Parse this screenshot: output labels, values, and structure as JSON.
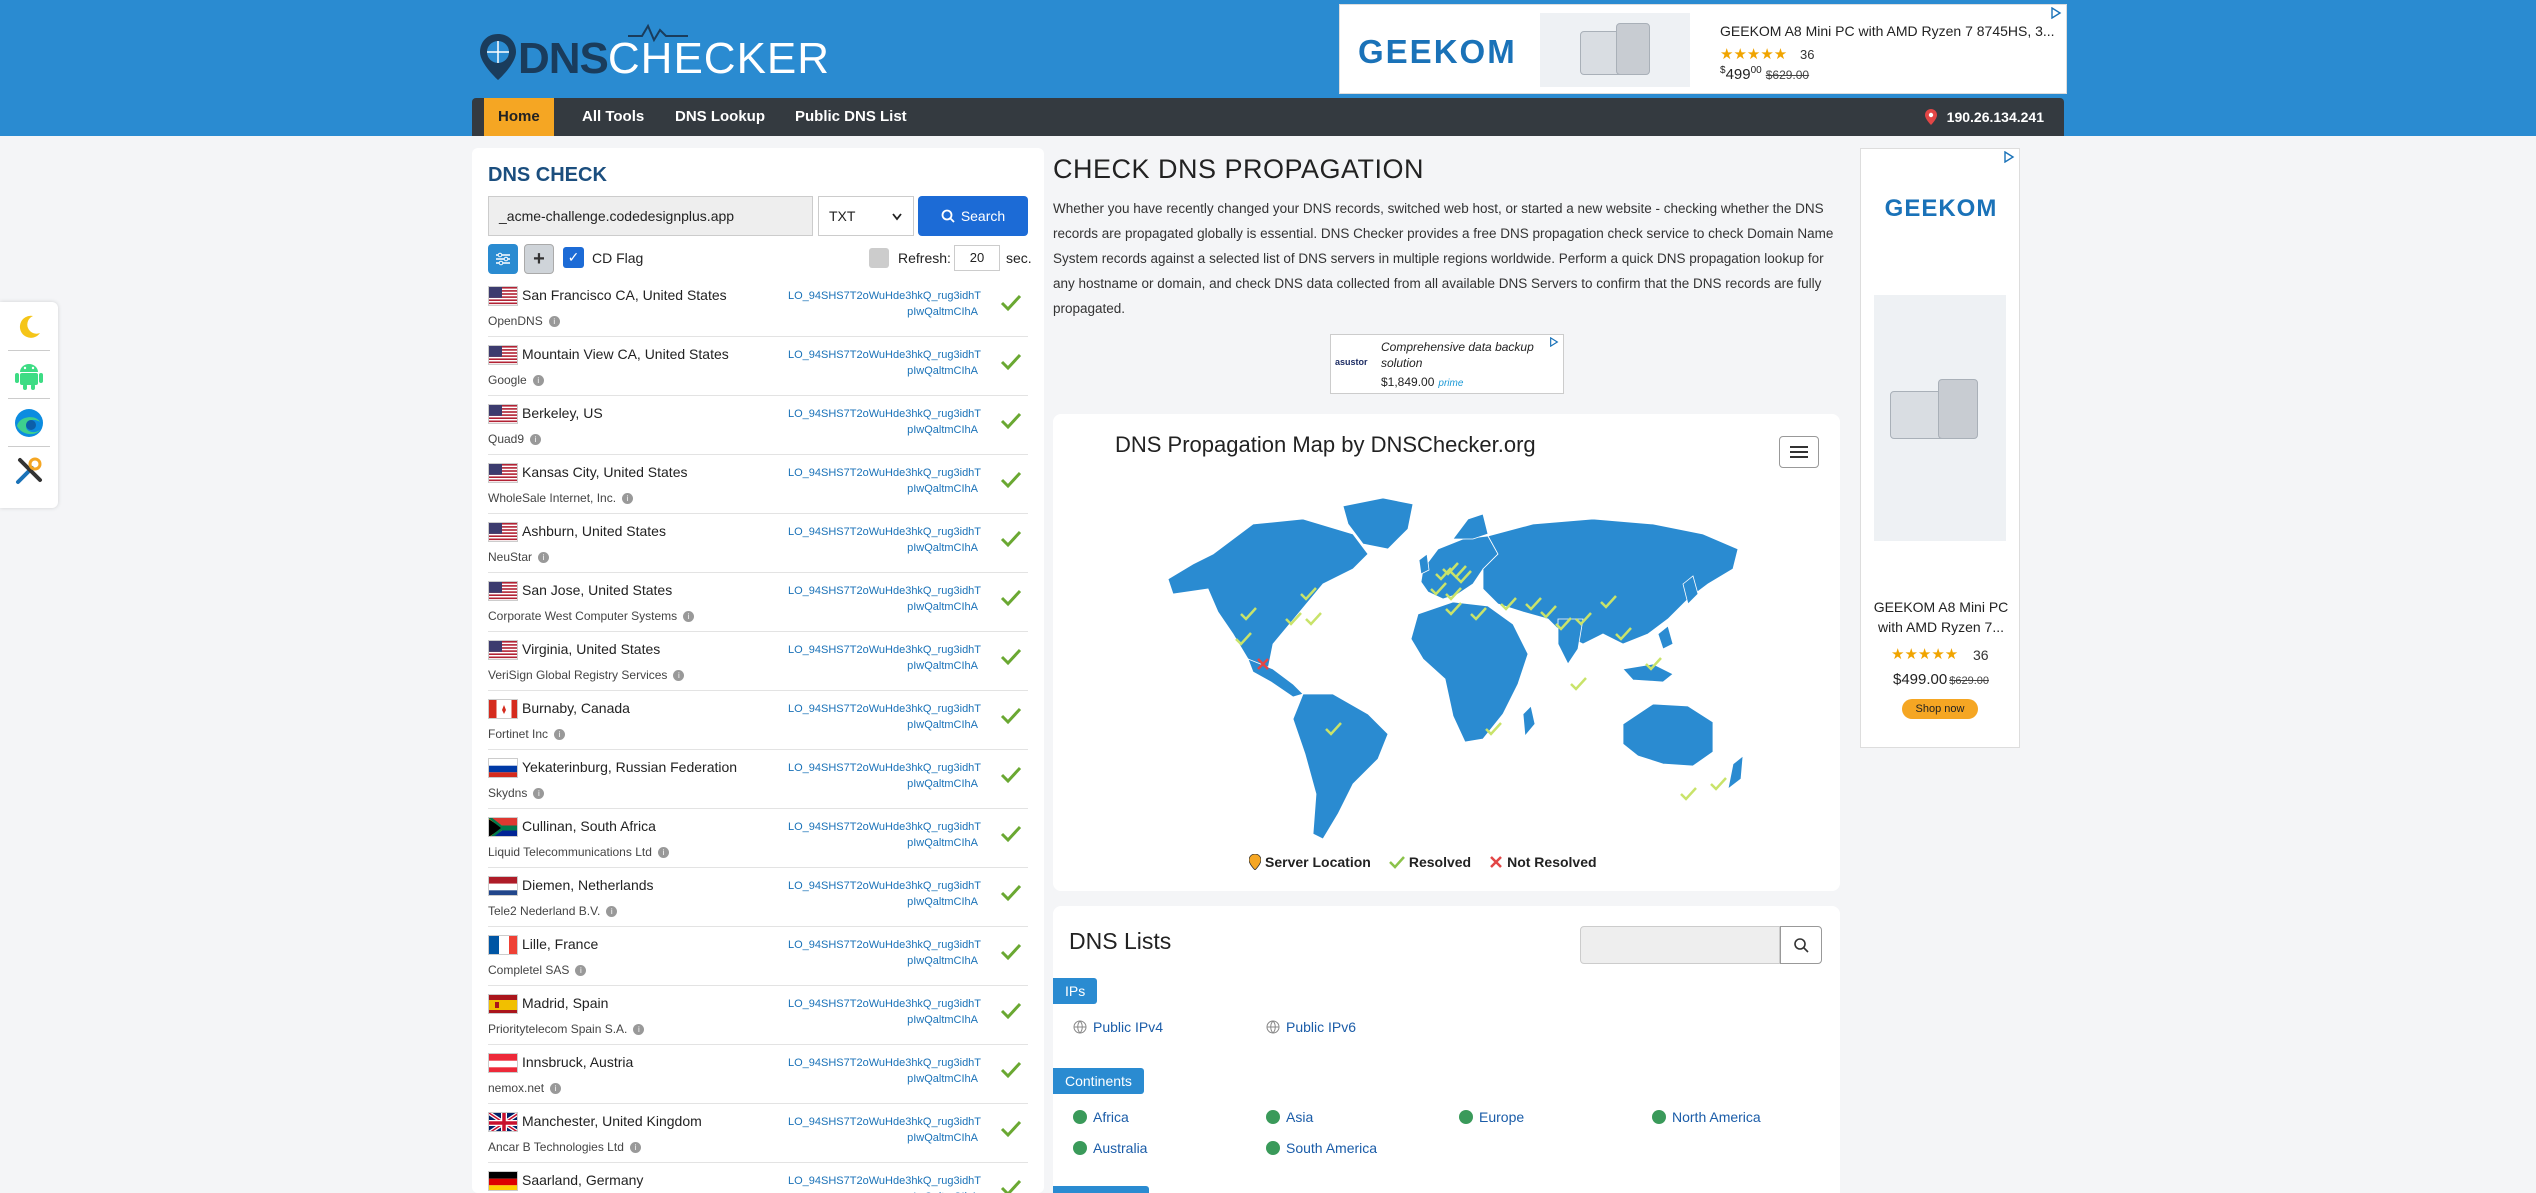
{
  "header": {
    "logo_dns": "DNS",
    "logo_checker": "CHECKER",
    "top_ad": {
      "brand": "GEEKOM",
      "title": "GEEKOM A8 Mini PC with AMD Ryzen 7 8745HS, 3...",
      "stars": "★★★★★",
      "rating_count": "36",
      "price_dollar": "$",
      "price_main": "499",
      "price_cents": "00",
      "old_price": "$629.00"
    },
    "nav": [
      "Home",
      "All Tools",
      "DNS Lookup",
      "Public DNS List"
    ],
    "ip": "190.26.134.241"
  },
  "check": {
    "title": "DNS CHECK",
    "domain": "_acme-challenge.codedesignplus.app",
    "record_type": "TXT",
    "search_label": "Search",
    "cd_flag_label": "CD Flag",
    "refresh_label": "Refresh:",
    "refresh_value": "20",
    "refresh_unit": "sec.",
    "result_line1": "LO_94SHS7T2oWuHde3hkQ_rug3idhT",
    "result_line2": "pIwQaltmCIhA",
    "rows": [
      {
        "flag": "us",
        "location": "San Francisco CA, United States",
        "provider": "OpenDNS"
      },
      {
        "flag": "us",
        "location": "Mountain View CA, United States",
        "provider": "Google"
      },
      {
        "flag": "us",
        "location": "Berkeley, US",
        "provider": "Quad9"
      },
      {
        "flag": "us",
        "location": "Kansas City, United States",
        "provider": "WholeSale Internet, Inc."
      },
      {
        "flag": "us",
        "location": "Ashburn, United States",
        "provider": "NeuStar"
      },
      {
        "flag": "us",
        "location": "San Jose, United States",
        "provider": "Corporate West Computer Systems"
      },
      {
        "flag": "us",
        "location": "Virginia, United States",
        "provider": "VeriSign Global Registry Services"
      },
      {
        "flag": "ca",
        "location": "Burnaby, Canada",
        "provider": "Fortinet Inc"
      },
      {
        "flag": "ru",
        "location": "Yekaterinburg, Russian Federation",
        "provider": "Skydns"
      },
      {
        "flag": "za",
        "location": "Cullinan, South Africa",
        "provider": "Liquid Telecommunications Ltd"
      },
      {
        "flag": "nl",
        "location": "Diemen, Netherlands",
        "provider": "Tele2 Nederland B.V."
      },
      {
        "flag": "fr",
        "location": "Lille, France",
        "provider": "Completel SAS"
      },
      {
        "flag": "es",
        "location": "Madrid, Spain",
        "provider": "Prioritytelecom Spain S.A."
      },
      {
        "flag": "at",
        "location": "Innsbruck, Austria",
        "provider": "nemox.net"
      },
      {
        "flag": "gb",
        "location": "Manchester, United Kingdom",
        "provider": "Ancar B Technologies Ltd"
      },
      {
        "flag": "de",
        "location": "Saarland, Germany",
        "provider": ""
      }
    ]
  },
  "main": {
    "title": "CHECK DNS PROPAGATION",
    "description": "Whether you have recently changed your DNS records, switched web host, or started a new website - checking whether the DNS records are propagated globally is essential. DNS Checker provides a free DNS propagation check service to check Domain Name System records against a selected list of DNS servers in multiple regions worldwide. Perform a quick DNS propagation lookup for any hostname or domain, and check DNS data collected from all available DNS Servers to confirm that the DNS records are fully propagated.",
    "mid_ad": {
      "logo": "asustor",
      "text": "Comprehensive data backup solution",
      "price": "$1,849.00",
      "prime": "prime"
    },
    "map": {
      "title": "DNS Propagation Map by DNSChecker.org",
      "legend": [
        "Server Location",
        "Resolved",
        "Not Resolved"
      ]
    },
    "lists": {
      "title": "DNS Lists",
      "ips_badge": "IPs",
      "ips": [
        "Public IPv4",
        "Public IPv6"
      ],
      "continents_badge": "Continents",
      "continents": [
        "Africa",
        "Asia",
        "Europe",
        "North America",
        "Australia",
        "South America"
      ]
    }
  },
  "right_ad": {
    "brand": "GEEKOM",
    "title": "GEEKOM A8 Mini PC with AMD Ryzen 7...",
    "stars": "★★★★★",
    "rating_count": "36",
    "price": "$499.00",
    "old_price": "$629.00",
    "cta": "Shop now"
  },
  "colors": {
    "header": "#2a8bd1",
    "nav": "#343a40",
    "nav_active": "#f5a623",
    "map_land": "#2a8bd1",
    "resolved": "#8bc34a",
    "not_resolved": "#e24646"
  }
}
